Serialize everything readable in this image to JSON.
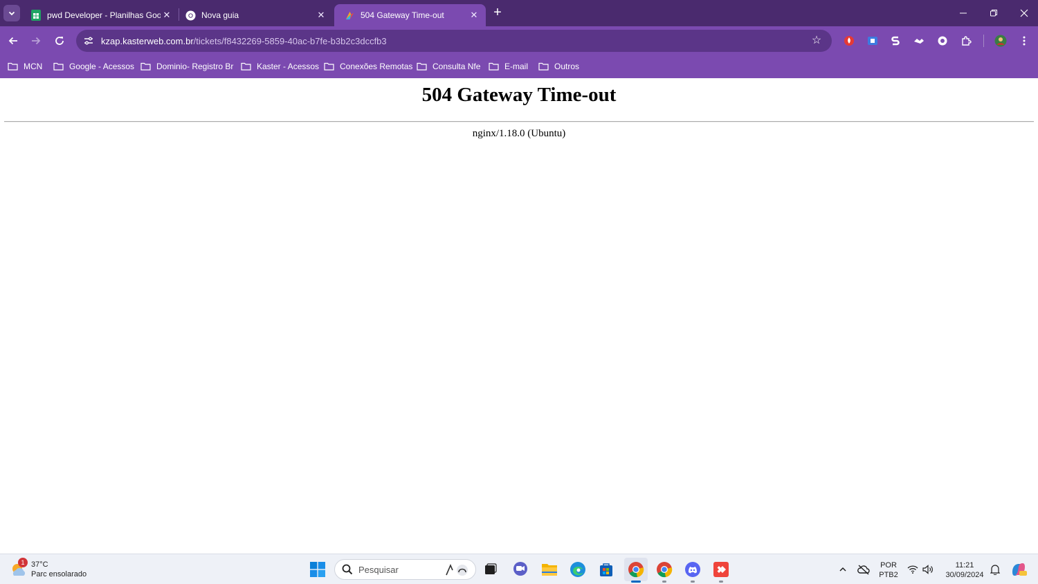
{
  "browser": {
    "tabs": [
      {
        "title": "pwd Developer - Planilhas Goog",
        "icon": "google-sheets-icon"
      },
      {
        "title": "Nova guia",
        "icon": "chrome-icon"
      },
      {
        "title": "504 Gateway Time-out",
        "icon": "kasterweb-icon"
      }
    ],
    "active_tab": 2,
    "url_host": "kzap.kasterweb.com.br",
    "url_path": "/tickets/f8432269-5859-40ac-b7fe-b3b2c3dccfb3",
    "colors": {
      "frame": "#4a2a6e",
      "toolbar": "#7b4ab0",
      "omnibox": "#5b3588"
    }
  },
  "bookmarks": [
    {
      "label": "MCN"
    },
    {
      "label": "Google - Acessos"
    },
    {
      "label": "Dominio- Registro Br"
    },
    {
      "label": "Kaster - Acessos"
    },
    {
      "label": "Conexões Remotas"
    },
    {
      "label": "Consulta Nfe"
    },
    {
      "label": "E-mail"
    },
    {
      "label": "Outros"
    }
  ],
  "page": {
    "heading": "504 Gateway Time-out",
    "server": "nginx/1.18.0 (Ubuntu)"
  },
  "taskbar": {
    "weather": {
      "temp": "37°C",
      "condition": "Parc ensolarado",
      "badge": "1"
    },
    "search_placeholder": "Pesquisar",
    "language": {
      "line1": "POR",
      "line2": "PTB2"
    },
    "clock": {
      "time": "11:21",
      "date": "30/09/2024"
    }
  }
}
